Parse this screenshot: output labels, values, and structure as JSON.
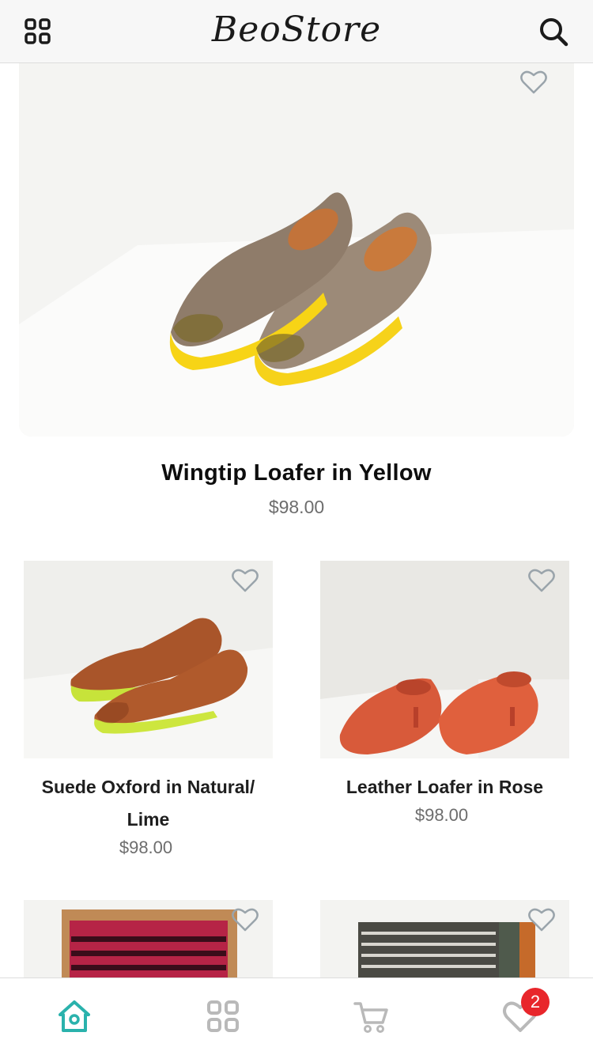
{
  "header": {
    "logo": "BeoStore",
    "menu_icon": "grid-menu-icon",
    "search_icon": "search-icon"
  },
  "featured": {
    "title": "Wingtip Loafer in Yellow",
    "price": "$98.00"
  },
  "products": [
    {
      "title": "Suede Oxford in Natural/ Lime",
      "price": "$98.00"
    },
    {
      "title": "Leather Loafer in Rose",
      "price": "$98.00"
    },
    {
      "title": "",
      "price": ""
    },
    {
      "title": "",
      "price": ""
    }
  ],
  "tabbar": {
    "items": [
      {
        "icon": "home-icon",
        "active": true
      },
      {
        "icon": "grid-icon",
        "active": false
      },
      {
        "icon": "cart-icon",
        "active": false
      },
      {
        "icon": "heart-icon",
        "active": false
      }
    ],
    "wishlist_badge": "2"
  },
  "colors": {
    "accent": "#2ab2ac",
    "badge": "#e8262b",
    "icon_gray": "#b9b9b9",
    "price_gray": "#6d6d6d"
  }
}
